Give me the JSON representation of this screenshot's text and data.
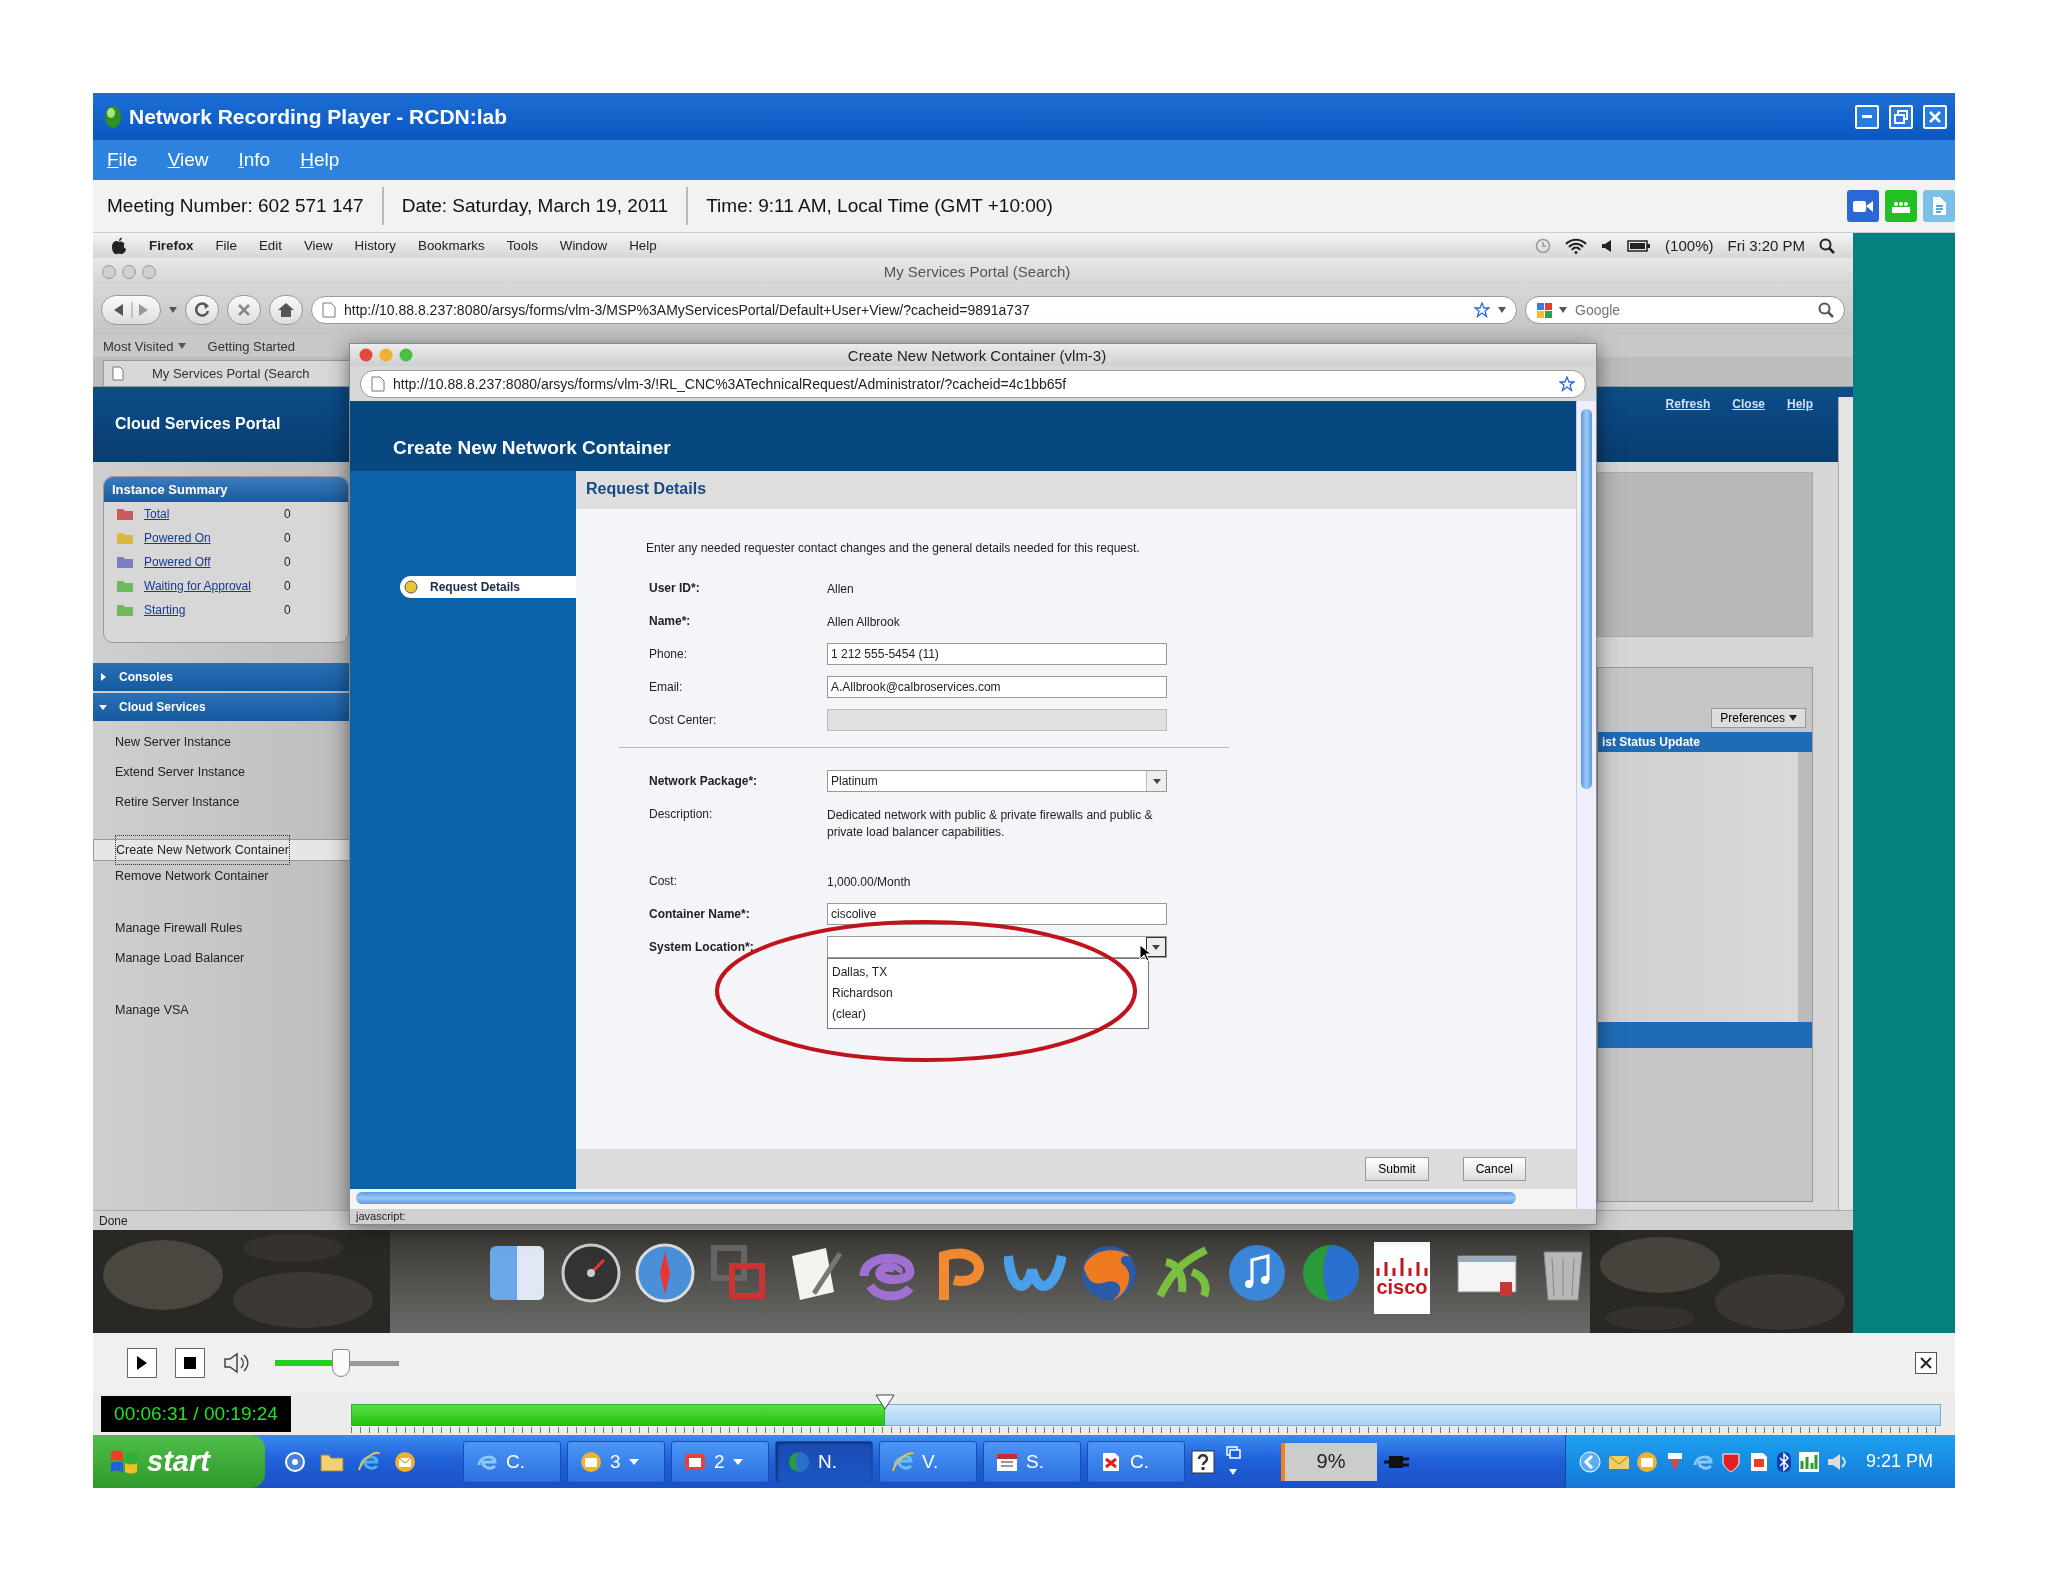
{
  "window": {
    "title": "Network Recording Player - RCDN:lab"
  },
  "menu": [
    "File",
    "View",
    "Info",
    "Help"
  ],
  "meeting_info": [
    "Meeting Number: 602 571 147",
    "Date: Saturday, March 19, 2011",
    "Time: 9:11 AM, Local Time (GMT +10:00)"
  ],
  "mac_menubar": {
    "app": "Firefox",
    "items": [
      "File",
      "Edit",
      "View",
      "History",
      "Bookmarks",
      "Tools",
      "Window",
      "Help"
    ],
    "battery": "(100%)",
    "clock": "Fri 3:20 PM"
  },
  "browser": {
    "title": "My Services Portal (Search)",
    "url": "http://10.88.8.237:8080/arsys/forms/vlm-3/MSP%3AMyServicesPortal/Default+User+View/?cacheid=9891a737",
    "search_placeholder": "Google",
    "bookmarks": [
      "Most Visited",
      "Getting Started"
    ],
    "tab": "My Services Portal (Search",
    "status": "Done"
  },
  "portal": {
    "title": "Cloud Services Portal",
    "links": [
      "Refresh",
      "Close",
      "Help"
    ],
    "summary": {
      "title": "Instance Summary",
      "rows": [
        {
          "label": "Total",
          "count": "0",
          "color": "#c85a5a"
        },
        {
          "label": "Powered On",
          "count": "0",
          "color": "#d8b840"
        },
        {
          "label": "Powered Off",
          "count": "0",
          "color": "#7c7cc0"
        },
        {
          "label": "Waiting for Approval",
          "count": "0",
          "color": "#70b860"
        },
        {
          "label": "Starting",
          "count": "0",
          "color": "#70b860"
        }
      ]
    },
    "sections": [
      {
        "label": "Consoles",
        "expanded": false
      },
      {
        "label": "Cloud Services",
        "expanded": true,
        "groups": [
          {
            "items": [
              {
                "label": "New Server Instance",
                "selected": false
              },
              {
                "label": "Extend Server Instance",
                "selected": false
              },
              {
                "label": "Retire Server Instance",
                "selected": false
              }
            ]
          },
          {
            "items": [
              {
                "label": "Create New Network Container",
                "selected": true
              },
              {
                "label": "Remove Network Container",
                "selected": false
              }
            ]
          },
          {
            "items": [
              {
                "label": "Manage Firewall Rules",
                "selected": false
              },
              {
                "label": "Manage Load Balancer",
                "selected": false
              }
            ]
          },
          {
            "items": [
              {
                "label": "Manage VSA",
                "selected": false
              }
            ]
          }
        ]
      }
    ],
    "preferences": "Preferences",
    "status_column": "ist Status Update"
  },
  "popup": {
    "title": "Create New Network Container (vlm-3)",
    "url": "http://10.88.8.237:8080/arsys/forms/vlm-3/!RL_CNC%3ATechnicalRequest/Administrator/?cacheid=4c1bb65f",
    "heading": "Create New Network Container",
    "steps": [
      {
        "label": "Request Details",
        "selected": true
      }
    ],
    "section": "Request Details",
    "intro": "Enter any needed requester contact changes and the general details needed for this request.",
    "contact_fields": [
      {
        "kind": "static",
        "label": "User ID*:",
        "required": true,
        "value": "Allen"
      },
      {
        "kind": "static",
        "label": "Name*:",
        "required": true,
        "value": "Allen Allbrook"
      },
      {
        "kind": "input",
        "label": "Phone:",
        "required": false,
        "value": "1 212 555-5454 (11)"
      },
      {
        "kind": "input",
        "label": "Email:",
        "required": false,
        "value": "A.Allbrook@calbroservices.com"
      },
      {
        "kind": "disabled",
        "label": "Cost Center:",
        "required": false
      }
    ],
    "package_fields": [
      {
        "kind": "select",
        "label": "Network Package*:",
        "required": true,
        "value": "Platinum",
        "expanded": false
      },
      {
        "kind": "static",
        "label": "Description:",
        "required": false,
        "value": "Dedicated network with public & private firewalls and public & private load balancer capabilities."
      },
      {
        "kind": "static",
        "label": "Cost:",
        "required": false,
        "value": "1,000.00/Month"
      },
      {
        "kind": "input",
        "label": "Container Name*:",
        "required": true,
        "value": "ciscolive"
      },
      {
        "kind": "select",
        "label": "System Location*:",
        "required": true,
        "expanded": true,
        "options": [
          "Dallas, TX",
          "Richardson",
          "(clear)"
        ]
      }
    ],
    "buttons": [
      "Submit",
      "Cancel"
    ],
    "status": "javascript:"
  },
  "dock": {
    "logo_text": "cisco"
  },
  "player": {
    "volume": {
      "level": 0.53
    },
    "time": "00:06:31 / 00:19:24",
    "progress": {
      "level": 0.336
    }
  },
  "taskbar": {
    "start": "start",
    "tasks": [
      {
        "label": "C.",
        "selected": false,
        "menu": false
      },
      {
        "label": "3",
        "selected": false,
        "menu": true
      },
      {
        "label": "2",
        "selected": false,
        "menu": true
      },
      {
        "label": "N.",
        "selected": true,
        "menu": false
      },
      {
        "label": "V.",
        "selected": false,
        "menu": false
      },
      {
        "label": "S.",
        "selected": false,
        "menu": false
      },
      {
        "label": "C.",
        "selected": false,
        "menu": false
      }
    ],
    "cpu": "9%",
    "clock": "9:21 PM"
  }
}
